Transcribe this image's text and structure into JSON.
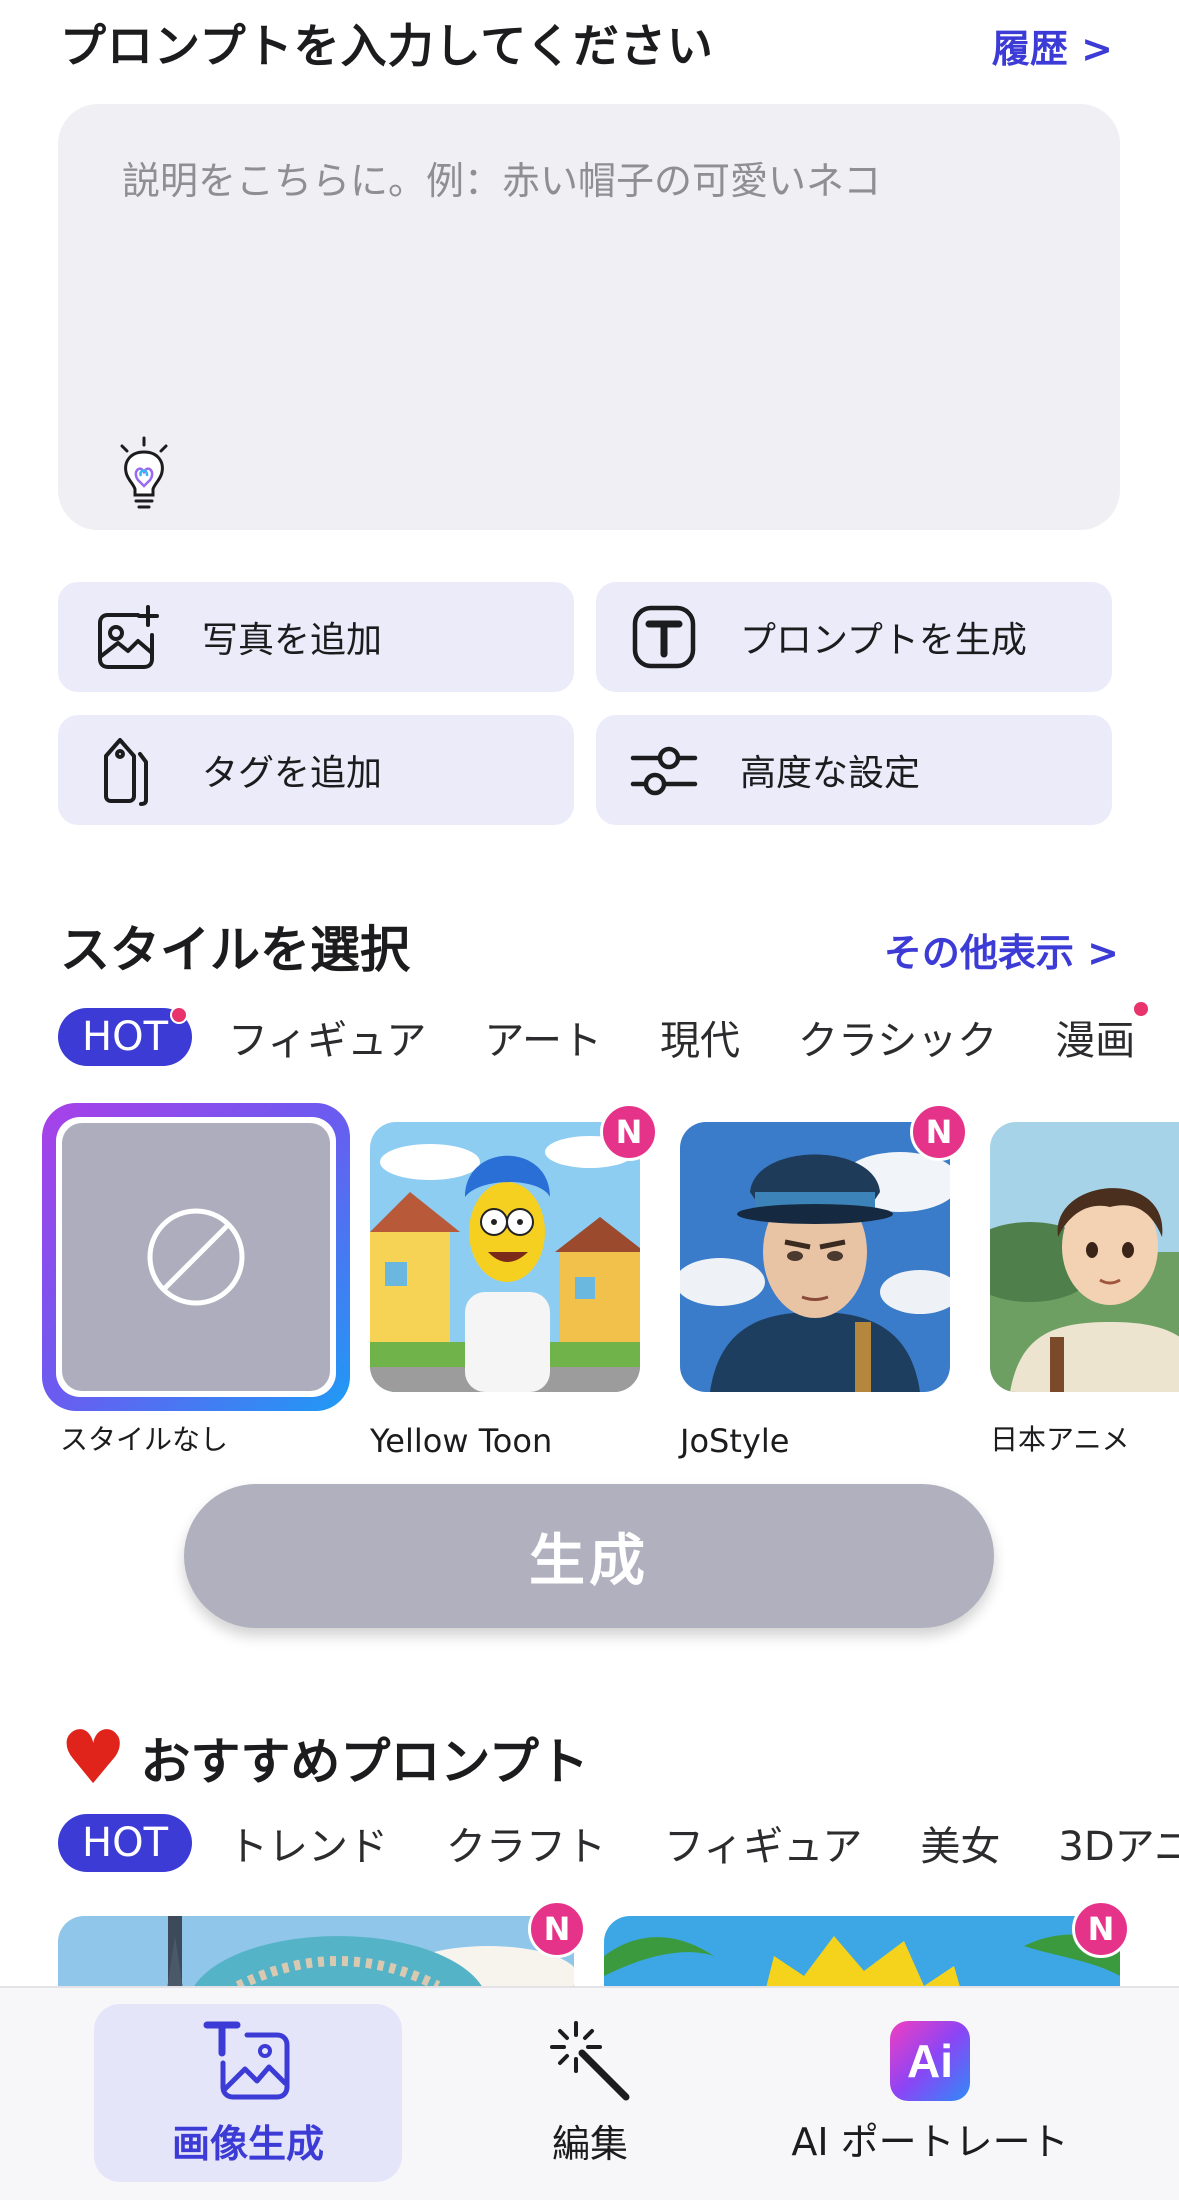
{
  "header": {
    "title": "プロンプトを入力してください",
    "history_link": "履歴 >"
  },
  "prompt": {
    "placeholder": "説明をこちらに。例：赤い帽子の可愛いネコ",
    "value": ""
  },
  "actions": {
    "add_photo": "写真を追加",
    "generate_prompt": "プロンプトを生成",
    "add_tag": "タグを追加",
    "advanced_settings": "高度な設定"
  },
  "styles": {
    "title": "スタイルを選択",
    "more_link": "その他表示 >",
    "tabs": [
      "HOT",
      "フィギュア",
      "アート",
      "現代",
      "クラシック",
      "漫画"
    ],
    "active_tab": "HOT",
    "items": [
      {
        "label": "スタイルなし",
        "selected": true,
        "badge": ""
      },
      {
        "label": "Yellow Toon",
        "selected": false,
        "badge": "N"
      },
      {
        "label": "JoStyle",
        "selected": false,
        "badge": "N"
      },
      {
        "label": "日本アニメ",
        "selected": false,
        "badge": ""
      }
    ]
  },
  "generate_button": "生成",
  "recommended": {
    "heart": "♥",
    "title": "おすすめプロンプト",
    "tabs": [
      "HOT",
      "トレンド",
      "クラフト",
      "フィギュア",
      "美女",
      "3Dアニ"
    ],
    "active_tab": "HOT",
    "badges": [
      "N",
      "N"
    ]
  },
  "bottom_nav": {
    "items": [
      {
        "label": "画像生成",
        "active": true
      },
      {
        "label": "編集",
        "active": false
      },
      {
        "label": "AI ポートレート",
        "active": false
      }
    ],
    "ai_icon_text": "Ai"
  },
  "colors": {
    "accent": "#3d3bd6",
    "badge": "#e6338a",
    "panel": "#efeff4",
    "button_disabled": "#b1b0be"
  }
}
